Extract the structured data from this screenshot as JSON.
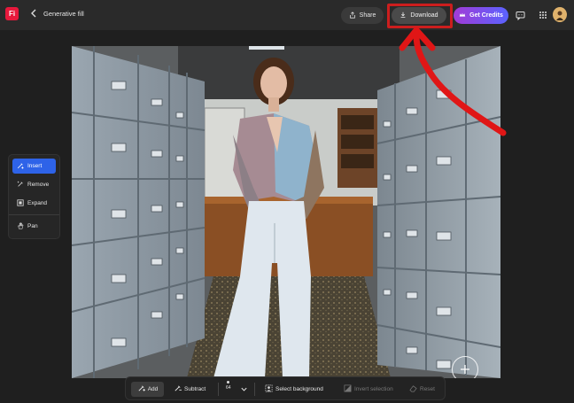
{
  "app": {
    "logo_text": "Fi",
    "title": "Generative fill"
  },
  "header": {
    "share_label": "Share",
    "download_label": "Download",
    "credits_label": "Get Credits",
    "icons": [
      "back-chevron-icon",
      "share-icon",
      "download-icon",
      "crown-icon",
      "feedback-icon",
      "apps-grid-icon",
      "avatar"
    ]
  },
  "tools": {
    "items": [
      {
        "label": "Insert",
        "icon": "insert-icon",
        "active": true
      },
      {
        "label": "Remove",
        "icon": "remove-icon",
        "active": false
      },
      {
        "label": "Expand",
        "icon": "expand-icon",
        "active": false
      },
      {
        "label": "Pan",
        "icon": "hand-icon",
        "active": false
      }
    ]
  },
  "bottom": {
    "add_label": "Add",
    "subtract_label": "Subtract",
    "brush_size": "64",
    "select_background_label": "Select background",
    "invert_selection_label": "Invert selection",
    "reset_label": "Reset"
  },
  "colors": {
    "accent_blue": "#2e63e8",
    "highlight_red": "#cc1e1e",
    "credits_gradient_start": "#a23bd6",
    "credits_gradient_end": "#5a63ff"
  }
}
